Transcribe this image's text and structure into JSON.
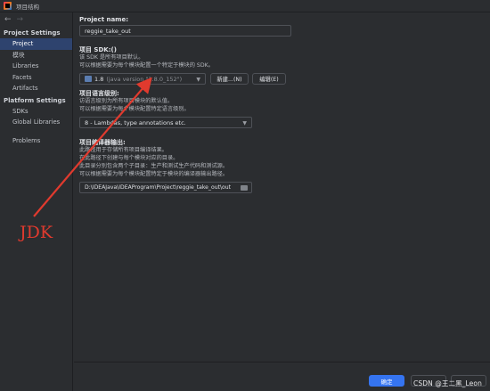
{
  "window": {
    "title": "项目结构"
  },
  "sidebar": {
    "nav": {
      "back": "←",
      "forward": "→"
    },
    "sections": [
      {
        "title": "Project Settings",
        "items": [
          "Project",
          "模块",
          "Libraries",
          "Facets",
          "Artifacts"
        ]
      },
      {
        "title": "Platform Settings",
        "items": [
          "SDKs",
          "Global Libraries"
        ]
      }
    ],
    "problems": "Problems",
    "selected": "Project"
  },
  "project": {
    "name_label": "Project name:",
    "name_value": "reggie_take_out",
    "sdk_label": "项目 SDK:()",
    "sdk_desc_1": "该 SDK 是所有项目默认。",
    "sdk_desc_2": "可以根据需要为每个模块配置一个特定于模块的 SDK。",
    "sdk_value": "1.8",
    "sdk_version": "(java version \"1.8.0_152\")",
    "new_button": "新建...(N)",
    "edit_button": "编辑(E)",
    "lang_label": "项目语言级别:",
    "lang_desc_1": "访语言级别为所有项目模块的默认值。",
    "lang_desc_2": "可以根据需要为每个模块配置特定语言级别。",
    "lang_value": "8 - Lambdas, type annotations etc.",
    "output_label": "项目编译器输出:",
    "output_desc_1": "此路径用于存储所有项目编译结果。",
    "output_desc_2": "在此路径下创建与每个模块对应的目录。",
    "output_desc_3": "此目录分别包含两个子目录：生产和测试生产代码和测试源。",
    "output_desc_4": "可以根据需要为每个模块配置特定于模块的编译器输出路径。",
    "output_value": "D:\\IDEAJava\\IDEAProgram\\Project\\reggie_take_out\\out"
  },
  "footer": {
    "ok_button": "确定",
    "watermark": "CSDN @王二黑_Leon"
  },
  "annotation": {
    "label": "JDK",
    "color": "#e03a2e"
  },
  "colors": {
    "selection": "#2e436e",
    "primary_button": "#3574f0",
    "background": "#2b2d30"
  }
}
